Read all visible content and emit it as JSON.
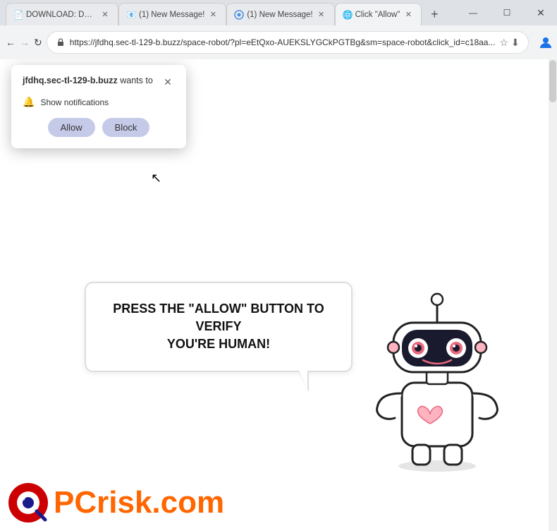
{
  "browser": {
    "tabs": [
      {
        "id": "tab1",
        "title": "DOWNLOAD: Deadpoo...",
        "active": false,
        "favicon": "📄"
      },
      {
        "id": "tab2",
        "title": "(1) New Message!",
        "active": false,
        "favicon": "📧"
      },
      {
        "id": "tab3",
        "title": "(1) New Message!",
        "active": false,
        "favicon": "⚙"
      },
      {
        "id": "tab4",
        "title": "Click \"Allow\"",
        "active": true,
        "favicon": "🌐"
      }
    ],
    "address": "https://jfdhq.sec-tl-129-b.buzz/space-robot/?pl=eEtQxo-AUEKSLYGCkPGTBg&sm=space-robot&click_id=c18aa...",
    "window_controls": [
      "—",
      "☐",
      "✕"
    ]
  },
  "notification_popup": {
    "site": "jfdhq.sec-tl-129-b.buzz",
    "wants_to": "wants to",
    "notification_label": "Show notifications",
    "allow_label": "Allow",
    "block_label": "Block",
    "close_icon": "✕"
  },
  "page": {
    "speech_text_line1": "PRESS THE \"ALLOW\" BUTTON TO VERIFY",
    "speech_text_line2": "YOU'RE HUMAN!"
  },
  "logo": {
    "pc_text": "PC",
    "risk_text": "risk.com"
  }
}
